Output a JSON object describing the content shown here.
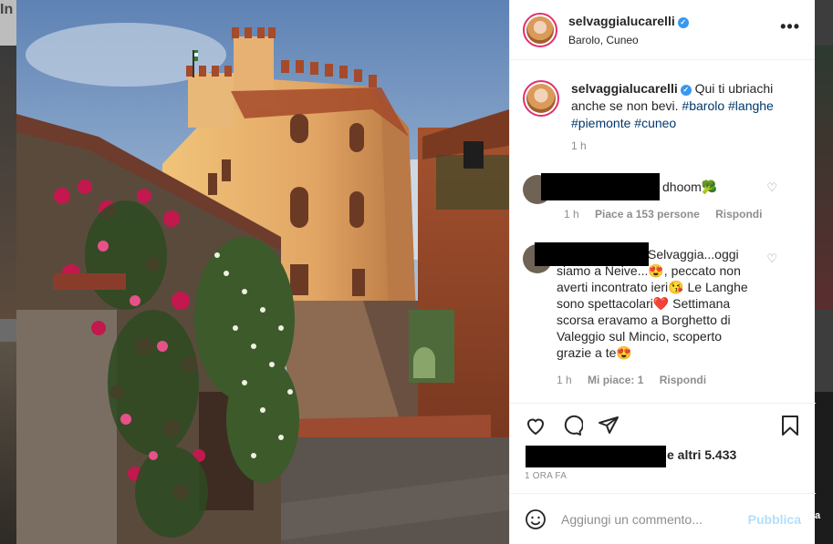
{
  "background": {
    "left_text": "In",
    "right_text": "a"
  },
  "post": {
    "username": "selvaggialucarelli",
    "location": "Barolo, Cuneo",
    "verified": true
  },
  "caption": {
    "username": "selvaggialucarelli",
    "text": "Qui ti ubriachi anche se non bevi.",
    "hashtags": [
      "#barolo",
      "#langhe",
      "#piemonte",
      "#cuneo"
    ],
    "time": "1 h"
  },
  "comments": [
    {
      "text": "dhoom🥦",
      "time": "1 h",
      "likes": "Piace a 153 persone",
      "reply": "Rispondi"
    },
    {
      "text": "Selvaggia...oggi siamo a Neive...😍, peccato non averti incontrato ieri😘 Le Langhe sono spettacolari❤️ Settimana scorsa eravamo a Borghetto di Valeggio sul Mincio, scoperto grazie a te😍",
      "time": "1 h",
      "likes": "Mi piace: 1",
      "reply": "Rispondi"
    }
  ],
  "likes_suffix": "e altri 5.433",
  "post_time": "1 ORA FA",
  "input": {
    "placeholder": "Aggiungi un commento...",
    "publish": "Pubblica"
  },
  "colors": {
    "link": "#00376b",
    "publish": "#b2dffc",
    "verified": "#3897f0",
    "story_ring": "#e1306c"
  }
}
